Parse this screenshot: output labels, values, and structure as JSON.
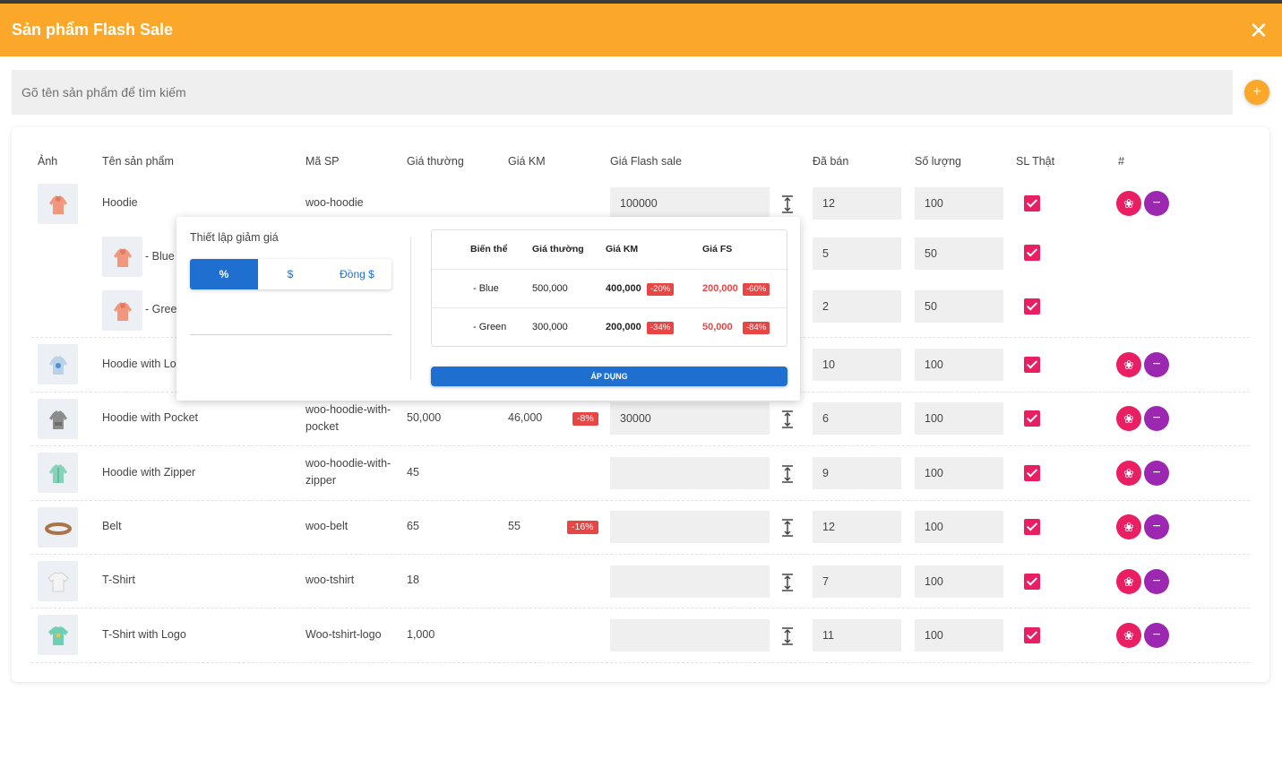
{
  "header": {
    "title": "Sản phẩm Flash Sale",
    "close_icon": "close-icon"
  },
  "search": {
    "placeholder": "Gõ tên sản phẩm để tìm kiếm",
    "add_icon": "plus-icon"
  },
  "colors": {
    "accent": "#fba72a",
    "primary": "#1e6fd0",
    "pink": "#e91e63",
    "purple": "#9c27b0",
    "danger": "#e84545"
  },
  "table": {
    "headers": [
      "Ảnh",
      "Tên sản phẩm",
      "Mã SP",
      "Giá thường",
      "Giá KM",
      "Giá Flash sale",
      "Đã bán",
      "Số lượng",
      "SL Thật",
      "#"
    ],
    "rows": [
      {
        "name": "Hoodie",
        "sku": "woo-hoodie",
        "price": "",
        "sale": "",
        "discount": "",
        "flash": "100000",
        "sold": "12",
        "qty": "100",
        "real": true
      },
      {
        "name": "- Blue",
        "sku": "",
        "price": "",
        "sale": "",
        "discount": "",
        "flash": "",
        "sold": "5",
        "qty": "50",
        "real": true
      },
      {
        "name": "- Green",
        "sku": "",
        "price": "",
        "sale": "",
        "discount": "",
        "flash": "",
        "sold": "2",
        "qty": "50",
        "real": true
      },
      {
        "name": "Hoodie with Logo",
        "sku": "",
        "price": "",
        "sale": "",
        "discount": "",
        "flash": "",
        "sold": "10",
        "qty": "100",
        "real": true
      },
      {
        "name": "Hoodie with Pocket",
        "sku_line1": "woo-hoodie-with-",
        "sku_line2": "pocket",
        "price": "50,000",
        "sale": "46,000",
        "discount": "-8%",
        "flash": "30000",
        "sold": "6",
        "qty": "100",
        "real": true
      },
      {
        "name": "Hoodie with Zipper",
        "sku_line1": "woo-hoodie-with-",
        "sku_line2": "zipper",
        "price": "45",
        "sale": "",
        "discount": "",
        "flash": "",
        "sold": "9",
        "qty": "100",
        "real": true
      },
      {
        "name": "Belt",
        "sku": "woo-belt",
        "price": "65",
        "sale": "55",
        "discount": "-16%",
        "flash": "",
        "sold": "12",
        "qty": "100",
        "real": true
      },
      {
        "name": "T-Shirt",
        "sku": "woo-tshirt",
        "price": "18",
        "sale": "",
        "discount": "",
        "flash": "",
        "sold": "7",
        "qty": "100",
        "real": true
      },
      {
        "name": "T-Shirt with Logo",
        "sku": "Woo-tshirt-logo",
        "price": "1,000",
        "sale": "",
        "discount": "",
        "flash": "",
        "sold": "11",
        "qty": "100",
        "real": true
      }
    ]
  },
  "popup": {
    "title": "Thiết lập giảm giá",
    "modes": [
      "%",
      "$",
      "Đồng $"
    ],
    "active_mode": "%",
    "variant_headers": [
      "Biến thể",
      "Giá thường",
      "Giá KM",
      "Giá FS"
    ],
    "variants": [
      {
        "name": "- Blue",
        "price": "500,000",
        "sale": "400,000",
        "sale_badge": "-20%",
        "fs": "200,000",
        "fs_badge": "-60%"
      },
      {
        "name": "- Green",
        "price": "300,000",
        "sale": "200,000",
        "sale_badge": "-34%",
        "fs": "50,000",
        "fs_badge": "-84%"
      }
    ],
    "apply_label": "ÁP DỤNG"
  }
}
